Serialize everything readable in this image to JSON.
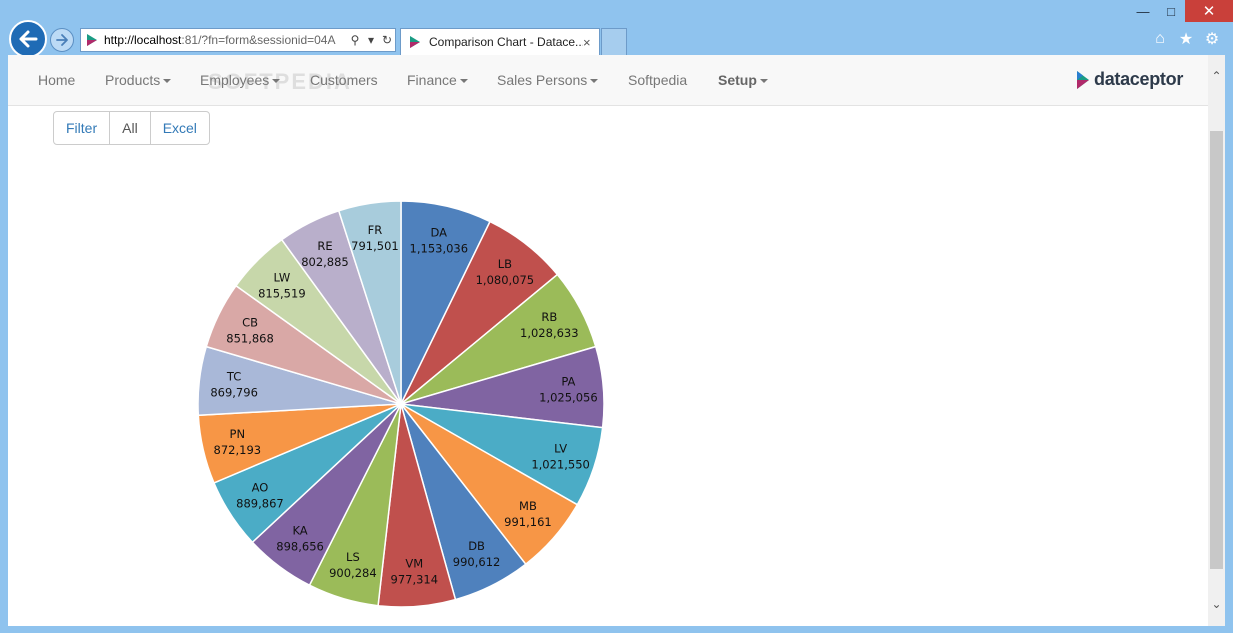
{
  "browser": {
    "url_host": "http://localhost",
    "url_rest": ":81/?fn=form&sessionid=04A",
    "tab_title": "Comparison Chart - Datace...",
    "tab_close": "×"
  },
  "nav": {
    "items": [
      {
        "label": "Home",
        "dropdown": false
      },
      {
        "label": "Products",
        "dropdown": true
      },
      {
        "label": "Employees",
        "dropdown": true
      },
      {
        "label": "Customers",
        "dropdown": false
      },
      {
        "label": "Finance",
        "dropdown": true
      },
      {
        "label": "Sales Persons",
        "dropdown": true
      },
      {
        "label": "Softpedia",
        "dropdown": false
      },
      {
        "label": "Setup",
        "dropdown": true
      }
    ],
    "brand": "dataceptor",
    "watermark": "SOFTPEDIA"
  },
  "toolbar": {
    "filter_label": "Filter",
    "all_label": "All",
    "excel_label": "Excel"
  },
  "colors": {
    "accent": "#337ab7",
    "window": "#8fc3ee",
    "close_button": "#c9403a"
  },
  "chart_data": {
    "type": "pie",
    "title": "",
    "slices": [
      {
        "label": "DA",
        "value": 1153036,
        "display": "1,153,036",
        "color": "#4f81bd"
      },
      {
        "label": "LB",
        "value": 1080075,
        "display": "1,080,075",
        "color": "#c0504d"
      },
      {
        "label": "RB",
        "value": 1028633,
        "display": "1,028,633",
        "color": "#9bbb59"
      },
      {
        "label": "PA",
        "value": 1025056,
        "display": "1,025,056",
        "color": "#8064a2"
      },
      {
        "label": "LV",
        "value": 1021550,
        "display": "1,021,550",
        "color": "#4bacc6"
      },
      {
        "label": "MB",
        "value": 991161,
        "display": "991,161",
        "color": "#f79646"
      },
      {
        "label": "DB",
        "value": 990612,
        "display": "990,612",
        "color": "#4f81bd"
      },
      {
        "label": "VM",
        "value": 977314,
        "display": "977,314",
        "color": "#c0504d"
      },
      {
        "label": "LS",
        "value": 900284,
        "display": "900,284",
        "color": "#9bbb59"
      },
      {
        "label": "KA",
        "value": 898656,
        "display": "898,656",
        "color": "#8064a2"
      },
      {
        "label": "AO",
        "value": 889867,
        "display": "889,867",
        "color": "#4bacc6"
      },
      {
        "label": "PN",
        "value": 872193,
        "display": "872,193",
        "color": "#f79646"
      },
      {
        "label": "TC",
        "value": 869796,
        "display": "869,796",
        "color": "#a9b8d8"
      },
      {
        "label": "CB",
        "value": 851868,
        "display": "851,868",
        "color": "#d9a8a6"
      },
      {
        "label": "LW",
        "value": 815519,
        "display": "815,519",
        "color": "#c7d7aa"
      },
      {
        "label": "RE",
        "value": 802885,
        "display": "802,885",
        "color": "#b9afcb"
      },
      {
        "label": "FR",
        "value": 791501,
        "display": "791,501",
        "color": "#a8ccdc"
      }
    ]
  }
}
